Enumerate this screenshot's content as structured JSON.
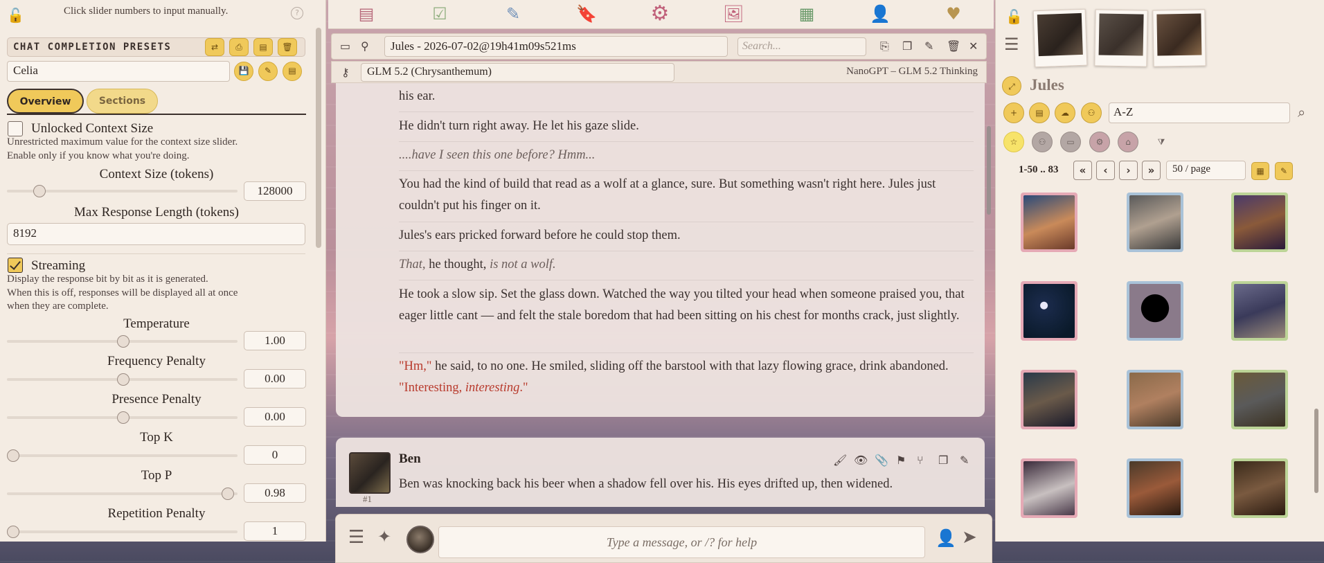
{
  "left": {
    "hint": "Click slider numbers to input manually.",
    "presets_title": "CHAT COMPLETION PRESETS",
    "preset_value": "Celia",
    "tabs": [
      "Overview",
      "Sections"
    ],
    "unlocked": {
      "label": "Unlocked Context Size",
      "desc1": "Unrestricted maximum value for the context size slider.",
      "desc2": "Enable only if you know what you're doing.",
      "checked": false
    },
    "context_size": {
      "label": "Context Size (tokens)",
      "value": "128000"
    },
    "max_response": {
      "label": "Max Response Length (tokens)",
      "value": "8192"
    },
    "streaming": {
      "label": "Streaming",
      "desc1": "Display the response bit by bit as it is generated.",
      "desc2": "When this is off, responses will be displayed all at once",
      "desc3": "when they are complete.",
      "checked": true
    },
    "sliders": [
      {
        "label": "Temperature",
        "value": "1.00"
      },
      {
        "label": "Frequency Penalty",
        "value": "0.00"
      },
      {
        "label": "Presence Penalty",
        "value": "0.00"
      },
      {
        "label": "Top K",
        "value": "0"
      },
      {
        "label": "Top P",
        "value": "0.98"
      },
      {
        "label": "Repetition Penalty",
        "value": "1"
      }
    ]
  },
  "chat": {
    "title": "Jules - 2026-07-02@19h41m09s521ms",
    "search_placeholder": "Search...",
    "model": "GLM 5.2 (Chrysanthemum)",
    "model_right": "NanoGPT – GLM 5.2 Thinking",
    "p1": "his ear.",
    "p2": "He didn't turn right away. He let his gaze slide.",
    "p3": "....have I seen this one before? Hmm...",
    "p4": "You had the kind of build that read as a wolf at a glance, sure. But something wasn't right here. Jules just couldn't put his finger on it.",
    "p5": "Jules's ears pricked forward before he could stop them.",
    "p6a": "That,",
    "p6b": " he thought, ",
    "p6c": "is not a wolf.",
    "p7": "He took a slow sip. Set the glass down. Watched the way you tilted your head when someone praised you, that eager little cant — and felt the stale boredom that had been sitting on his chest for months crack, just slightly.",
    "p8a": "\"Hm,\"",
    "p8b": " he said, to no one. He smiled, sliding off the barstool with that lazy flowing grace, drink abandoned. ",
    "p8c": "\"Interesting, ",
    "p8d": "interesting",
    "p8e": ".\"",
    "msg2_name": "Ben",
    "msg2_num": "#1",
    "msg2_text": "Ben was knocking back his beer when a shadow fell over his. His eyes drifted up, then widened.",
    "composer_placeholder": "Type a message, or /? for help"
  },
  "right": {
    "char_name": "Jules",
    "sort_value": "A-Z",
    "pager": "1-50 .. 83",
    "per_page": "50 / page"
  }
}
